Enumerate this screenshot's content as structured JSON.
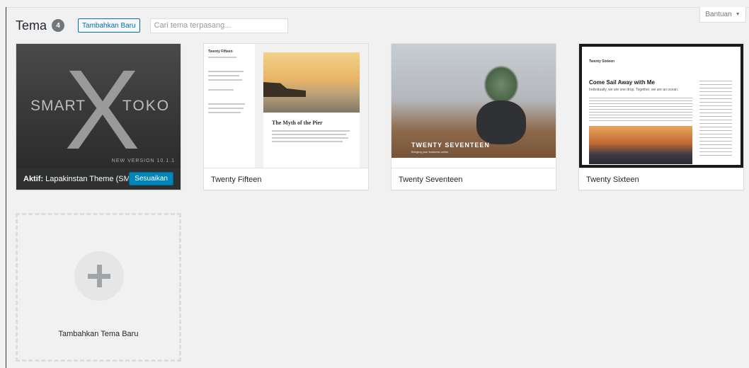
{
  "header": {
    "title": "Tema",
    "count": "4",
    "add_new_label": "Tambahkan Baru",
    "search_placeholder": "Cari tema terpasang..."
  },
  "help": {
    "label": "Bantuan",
    "arrow_icon": "caret-down-icon"
  },
  "themes": [
    {
      "active": true,
      "active_label": "Aktif:",
      "name": "Lapakinstan Theme (SMT...",
      "customize_label": "Sesuaikan",
      "screenshot": {
        "left_word": "SMART",
        "big_letter": "X",
        "right_word": "TOKO",
        "version": "NEW VERSION 10.1.1"
      }
    },
    {
      "active": false,
      "name": "Twenty Fifteen",
      "screenshot": {
        "site_title": "Twenty Fifteen",
        "post_title": "The Myth of the Pier"
      }
    },
    {
      "active": false,
      "name": "Twenty Seventeen",
      "screenshot": {
        "brand": "TWENTY SEVENTEEN",
        "tagline": "Bringing your business online"
      }
    },
    {
      "active": false,
      "name": "Twenty Sixteen",
      "screenshot": {
        "site_title": "Twenty Sixteen",
        "post_title": "Come Sail Away with Me",
        "subtitle": "Individually, we are one drop. Together, we are an ocean."
      }
    }
  ],
  "add_new_theme": {
    "label": "Tambahkan Tema Baru",
    "icon": "plus-icon"
  },
  "colors": {
    "accent": "#0073aa",
    "primary_button": "#0085ba",
    "background": "#f1f1f1"
  }
}
